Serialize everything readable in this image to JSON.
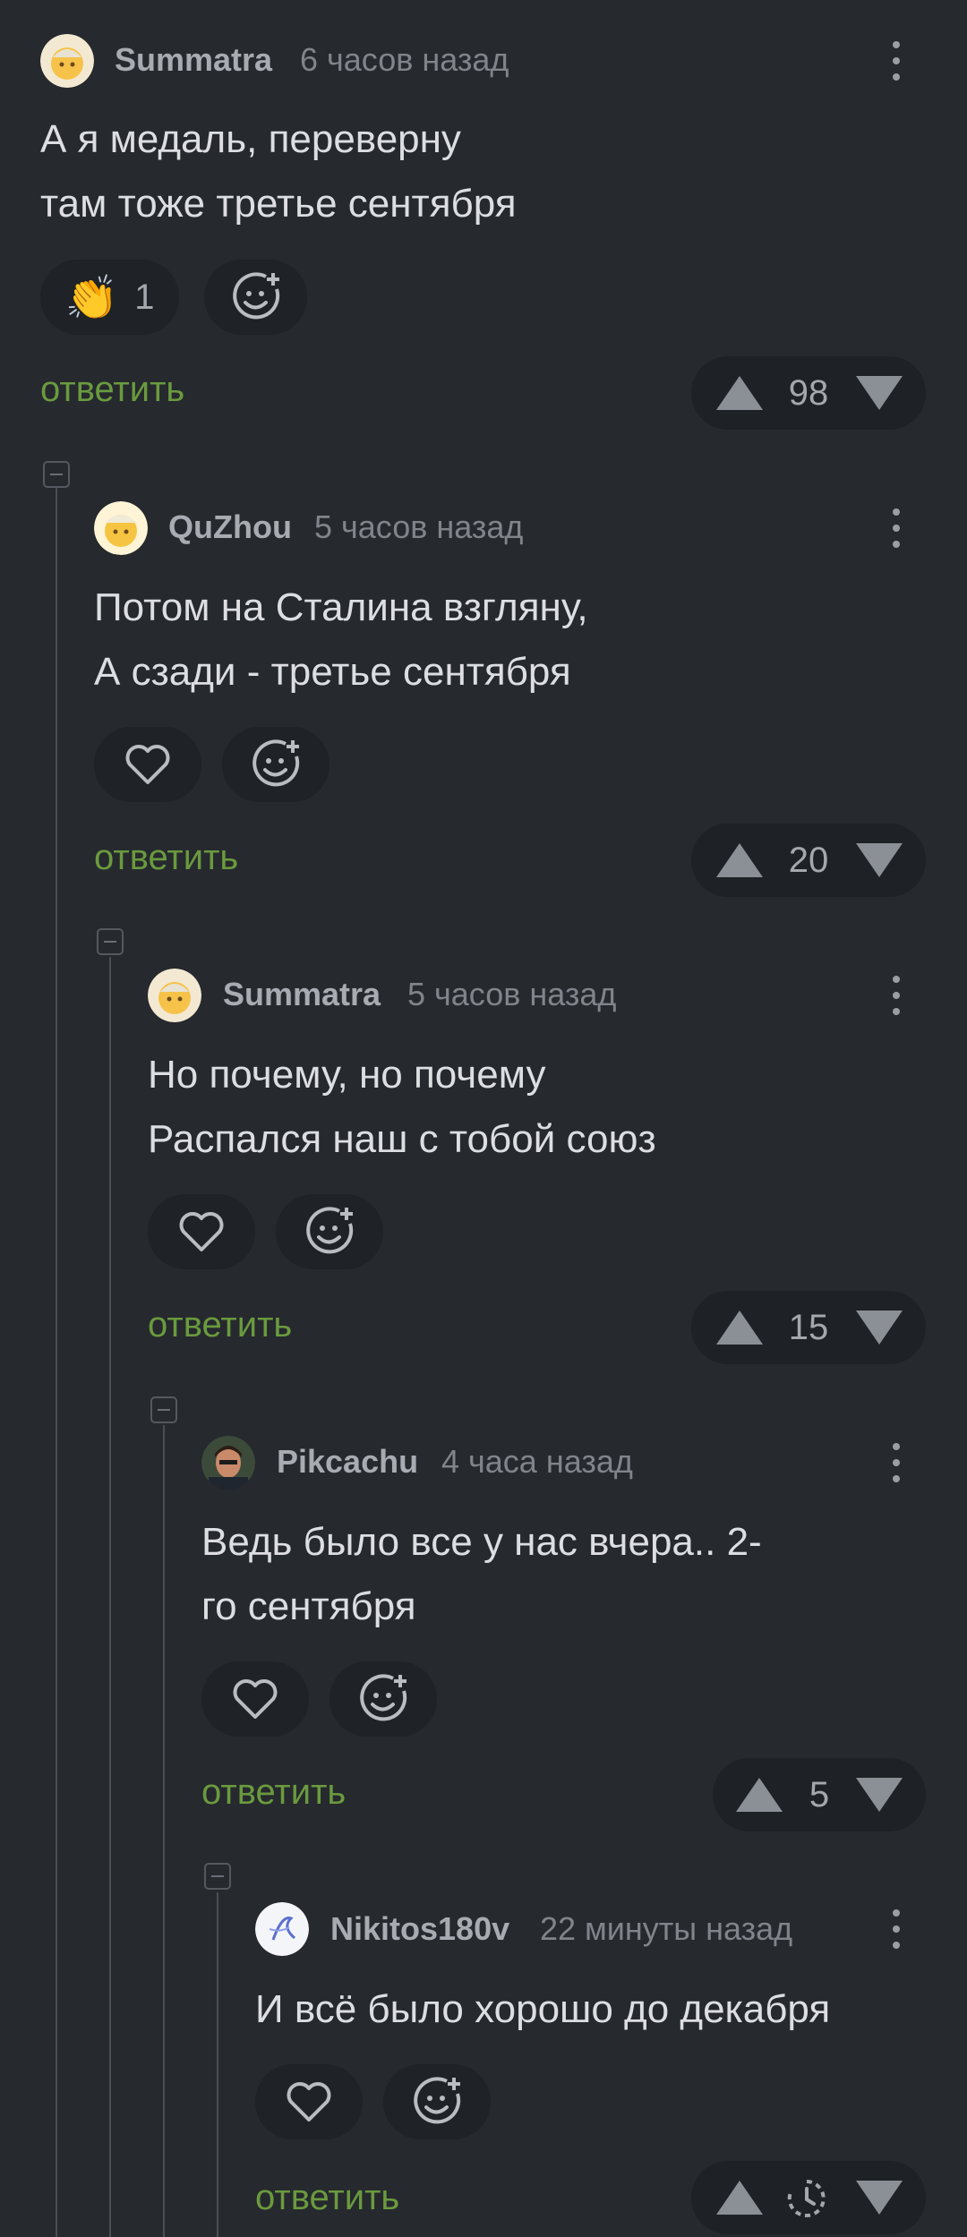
{
  "comments": [
    {
      "author": "Summatra",
      "time": "6 часов назад",
      "text": "А я медаль, переверну\nтам тоже третье сентября",
      "reaction_emoji": "👏",
      "reaction_count": "1",
      "reply_label": "ответить",
      "rating": "98"
    },
    {
      "author": "QuZhou",
      "time": "5 часов назад",
      "text": "Потом на Сталина взгляну,\nА сзади - третье сентября",
      "reply_label": "ответить",
      "rating": "20"
    },
    {
      "author": "Summatra",
      "time": "5 часов назад",
      "text": "Но почему, но почему\nРаспался наш с тобой союз",
      "reply_label": "ответить",
      "rating": "15"
    },
    {
      "author": "Pikcachu",
      "time": "4 часа назад",
      "text": "Ведь было все у нас вчера.. 2-\nго сентября",
      "reply_label": "ответить",
      "rating": "5"
    },
    {
      "author": "Nikitos180v",
      "time": "22 минуты назад",
      "text": "И всё было хорошо до декабря",
      "reply_label": "ответить",
      "rating": ""
    }
  ],
  "colors": {
    "background": "#26292e",
    "reply_link": "#6a9a3e",
    "pill": "#1f2226"
  }
}
